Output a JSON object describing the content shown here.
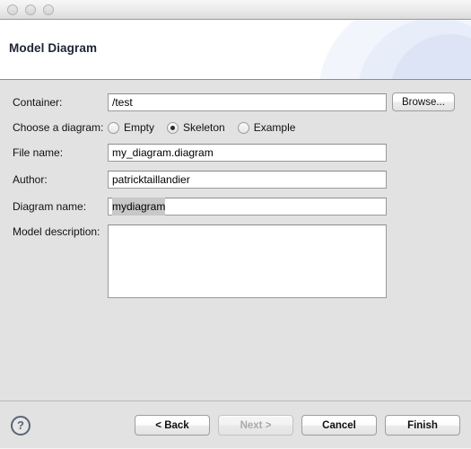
{
  "window": {
    "traffic_lights": [
      "close-button",
      "minimize-button",
      "zoom-button"
    ]
  },
  "banner": {
    "title": "Model Diagram"
  },
  "form": {
    "container": {
      "label": "Container:",
      "value": "/test",
      "placeholder": ""
    },
    "browse": {
      "label": "Browse..."
    },
    "diagram_choice": {
      "label": "Choose a diagram:",
      "options": [
        {
          "label": "Empty",
          "selected": false
        },
        {
          "label": "Skeleton",
          "selected": true
        },
        {
          "label": "Example",
          "selected": false
        }
      ]
    },
    "file_name": {
      "label": "File name:",
      "value": "my_diagram.diagram",
      "placeholder": ""
    },
    "author": {
      "label": "Author:",
      "value": "patricktaillandier",
      "placeholder": ""
    },
    "diagram_name": {
      "label": "Diagram name:",
      "value": "mydiagram",
      "placeholder": "",
      "selected": true
    },
    "model_description": {
      "label": "Model description:",
      "value": "",
      "placeholder": ""
    }
  },
  "footer": {
    "help_icon": "?",
    "buttons": [
      {
        "label": "< Back",
        "enabled": true
      },
      {
        "label": "Next >",
        "enabled": false
      },
      {
        "label": "Cancel",
        "enabled": true
      },
      {
        "label": "Finish",
        "enabled": true
      }
    ]
  },
  "colors": {
    "dialog_background": "#e2e2e2",
    "banner_background": "#ffffff",
    "banner_accent": "#dde4f5",
    "title_text": "#1d2433",
    "field_border": "#9a9a9a",
    "selection_highlight": "#c8c8c8",
    "help_icon": "#5a6478",
    "disabled_text": "#a9a9a9"
  }
}
